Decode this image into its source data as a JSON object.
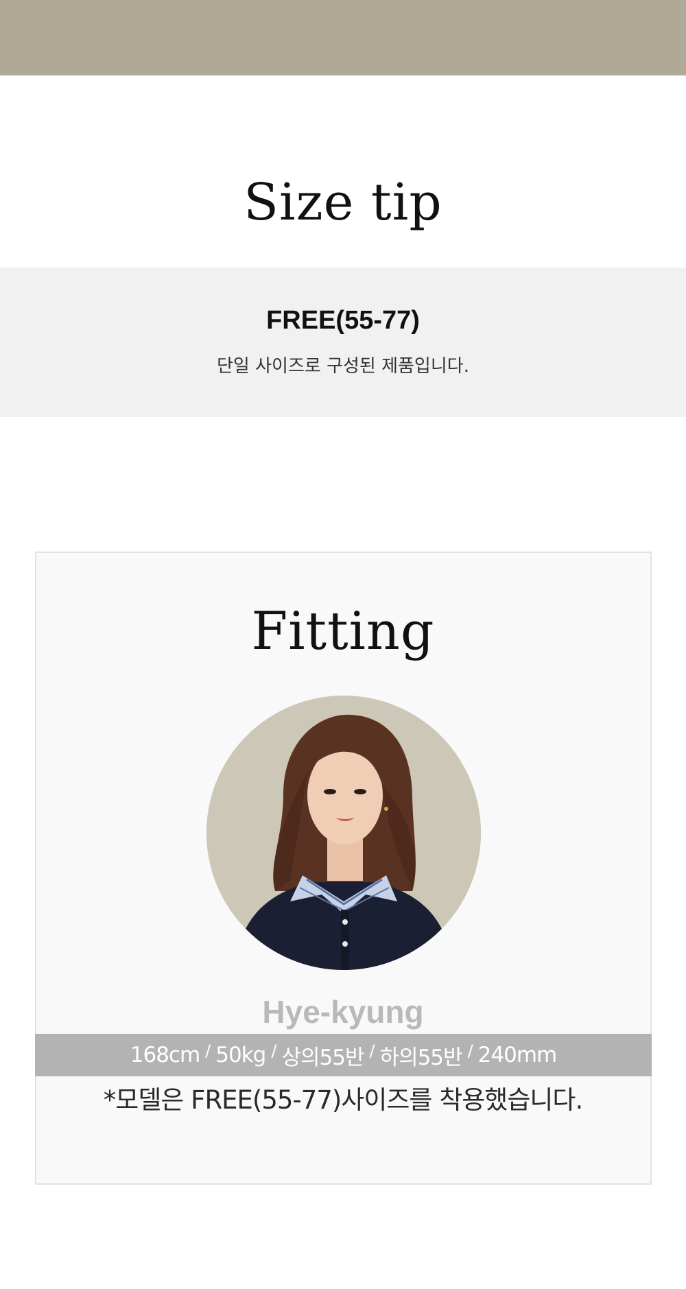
{
  "colors": {
    "top_bar": "#afa996",
    "size_band": "#f1f1f1",
    "fitting_box": "#f9f9f9",
    "stats_bar": "#b3b3b3",
    "model_name": "#b9b9b9"
  },
  "size_tip": {
    "title": "Size tip",
    "size_name": "FREE(55-77)",
    "description": "단일 사이즈로 구성된 제품입니다."
  },
  "fitting": {
    "title": "Fitting",
    "model_name": "Hye-kyung",
    "stats": {
      "height": "168cm",
      "weight": "50kg",
      "top": "상의55반",
      "bottom": "하의55반",
      "shoe": "240mm",
      "separator": "/"
    },
    "note": "*모델은 FREE(55-77)사이즈를 착용했습니다."
  }
}
